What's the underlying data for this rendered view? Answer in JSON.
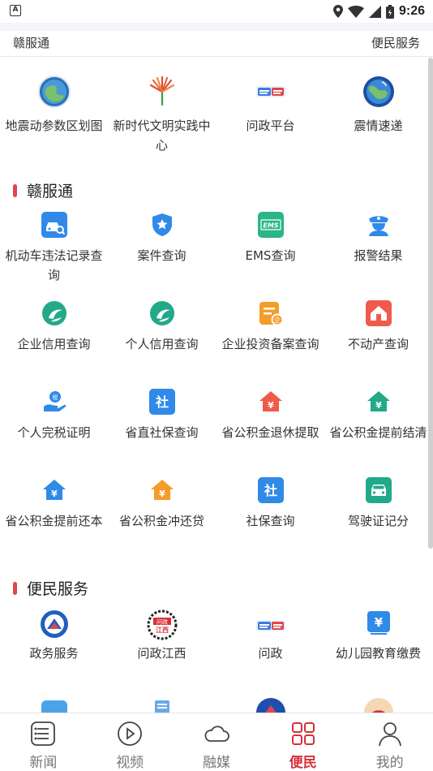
{
  "status": {
    "time": "9:26",
    "left_badge": "A"
  },
  "category_row": {
    "left": "赣服通",
    "right": "便民服务"
  },
  "top_services": [
    {
      "label": "地震动参数区划图",
      "icon": "earth-globe-icon"
    },
    {
      "label": "新时代文明实践中心",
      "icon": "civilization-logo-icon"
    },
    {
      "label": "问政平台",
      "icon": "wenzheng-logo-icon"
    },
    {
      "label": "震情速递",
      "icon": "earth-globe-icon"
    }
  ],
  "sections": [
    {
      "title": "赣服通",
      "items": [
        {
          "label": "机动车违法记录查询",
          "icon": "car-search-icon",
          "color": "#2f8ae8"
        },
        {
          "label": "案件查询",
          "icon": "police-shield-icon",
          "color": "#2f8ae8"
        },
        {
          "label": "EMS查询",
          "icon": "ems-icon",
          "color": "#2bb589"
        },
        {
          "label": "报警结果",
          "icon": "police-officer-icon",
          "color": "#2f8ae8"
        },
        {
          "label": "企业信用查询",
          "icon": "credit-swirl-icon",
          "color": "#22a98a"
        },
        {
          "label": "个人信用查询",
          "icon": "credit-swirl-icon",
          "color": "#22a98a"
        },
        {
          "label": "企业投资备案查询",
          "icon": "document-enterprise-icon",
          "color": "#f39c2b"
        },
        {
          "label": "不动产查询",
          "icon": "house-icon",
          "color": "#ef5a4b"
        },
        {
          "label": "个人完税证明",
          "icon": "tax-hand-icon",
          "color": "#2f8ae8"
        },
        {
          "label": "省直社保查询",
          "icon": "social-security-icon",
          "color": "#2f8ae8"
        },
        {
          "label": "省公积金退休提取",
          "icon": "house-yuan-icon",
          "color": "#ef5a4b"
        },
        {
          "label": "省公积金提前结清",
          "icon": "house-yuan-icon",
          "color": "#22a98a"
        },
        {
          "label": "省公积金提前还本",
          "icon": "house-yuan-icon",
          "color": "#2f8ae8"
        },
        {
          "label": "省公积金冲还贷",
          "icon": "house-yuan-icon",
          "color": "#f39c2b"
        },
        {
          "label": "社保查询",
          "icon": "social-security-icon",
          "color": "#2f8ae8"
        },
        {
          "label": "驾驶证记分",
          "icon": "car-front-icon",
          "color": "#22a98a"
        }
      ]
    },
    {
      "title": "便民服务",
      "items": [
        {
          "label": "政务服务",
          "icon": "government-emblem-icon",
          "color": "#1f5fbf"
        },
        {
          "label": "问政江西",
          "icon": "wenzheng-jiangxi-icon",
          "color": "#d8303a"
        },
        {
          "label": "问政",
          "icon": "wenzheng-logo-icon",
          "color": "#3a7be0"
        },
        {
          "label": "幼儿园教育缴费",
          "icon": "yuan-payment-icon",
          "color": "#2f8ae8"
        }
      ]
    }
  ],
  "bottom_nav": [
    {
      "label": "新闻",
      "icon": "news-list-icon",
      "active": false
    },
    {
      "label": "视频",
      "icon": "video-play-icon",
      "active": false
    },
    {
      "label": "融媒",
      "icon": "cloud-icon",
      "active": false
    },
    {
      "label": "便民",
      "icon": "grid-apps-icon",
      "active": true
    },
    {
      "label": "我的",
      "icon": "user-icon",
      "active": false
    }
  ]
}
